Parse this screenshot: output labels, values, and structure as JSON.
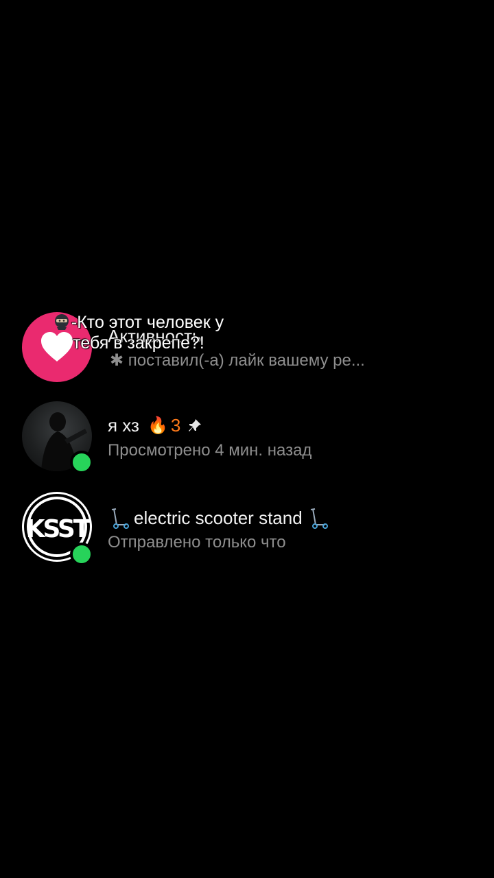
{
  "overlay": {
    "caption": "-Кто этот человек у тебя в закрепе?!",
    "caption_icon": "ninja-icon"
  },
  "activity": {
    "title": "Активность",
    "subtitle": "поставил(-а) лайк вашему ре...",
    "icon": "heart-icon",
    "accent_color": "#ea2a6f"
  },
  "chats": [
    {
      "name": "я хз",
      "streak_emoji": "🔥",
      "streak_count": "3",
      "pinned_icon": "pin-icon",
      "status": "Просмотрено 4 мин. назад",
      "online": true
    },
    {
      "name": "electric scooter stand",
      "prefix_icon": "scooter-icon",
      "suffix_icon": "scooter-icon",
      "logo_text": "KSST",
      "status": "Отправлено только что",
      "online": true
    }
  ],
  "colors": {
    "background": "#000000",
    "online": "#27d35a",
    "secondary_text": "#8e8e8e",
    "streak": "#ff7a1a"
  }
}
